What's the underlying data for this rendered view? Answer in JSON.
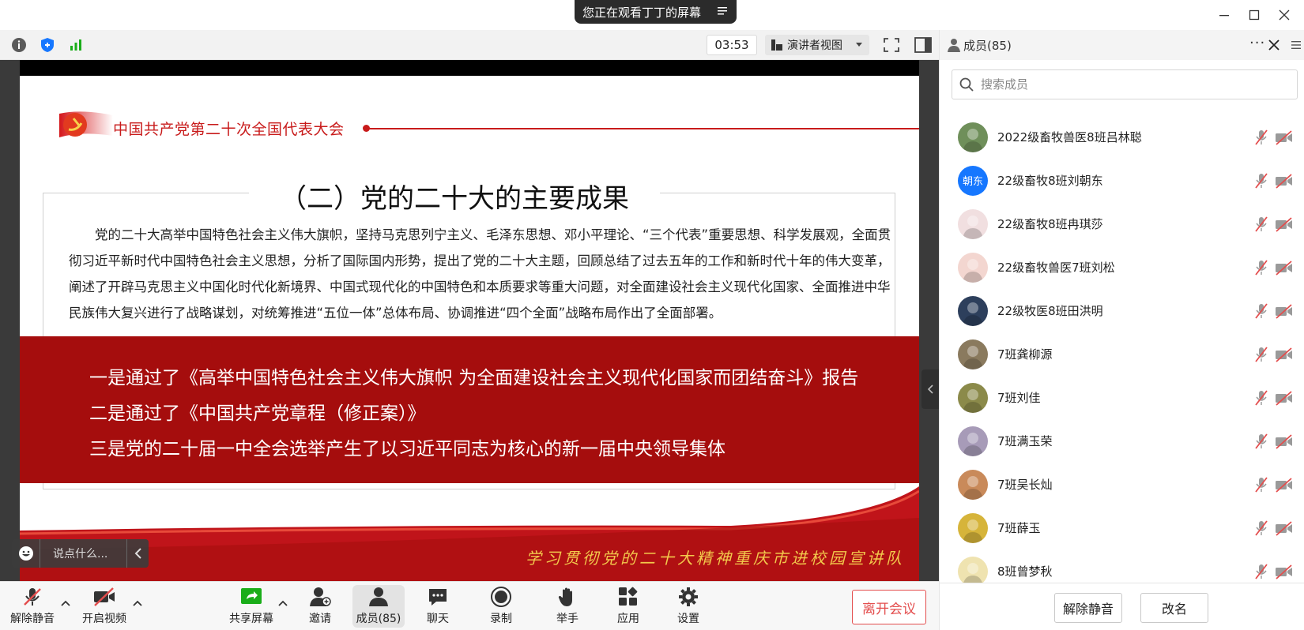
{
  "share_banner": {
    "text": "您正在观看丁丁的屏幕",
    "menu_icon": "menu-lines-icon"
  },
  "window_controls": [
    "minimize-icon",
    "maximize-icon",
    "close-icon"
  ],
  "meeting_toolbar": {
    "timer": "03:53",
    "view_mode": "演讲者视图",
    "icons": [
      "info-icon",
      "security-shield-icon",
      "signal-bars-icon",
      "fullscreen-icon",
      "layout-toggle-icon"
    ]
  },
  "slide": {
    "congress_title": "中国共产党第二十次全国代表大会",
    "section_title": "（二）党的二十大的主要成果",
    "paragraph": "党的二十大高举中国特色社会主义伟大旗帜，坚持马克思列宁主义、毛泽东思想、邓小平理论、“三个代表”重要思想、科学发展观，全面贯彻习近平新时代中国特色社会主义思想，分析了国际国内形势，提出了党的二十大主题，回顾总结了过去五年的工作和新时代十年的伟大变革，阐述了开辟马克思主义中国化时代化新境界、中国式现代化的中国特色和本质要求等重大问题，对全面建设社会主义现代化国家、全面推进中华民族伟大复兴进行了战略谋划，对统筹推进“五位一体”总体布局、协调推进“四个全面”战略布局作出了全面部署。",
    "points": [
      "一是通过了《高举中国特色社会主义伟大旗帜  为全面建设社会主义现代化国家而团结奋斗》报告",
      "二是通过了《中国共产党章程（修正案）》",
      "三是党的二十届一中全会选举产生了以习近平同志为核心的新一届中央领导集体"
    ],
    "ribbon_text": "学习贯彻党的二十大精神重庆市进校园宣讲队",
    "colors": {
      "party_red": "#a50d0d",
      "title_red": "#c81b1b",
      "ribbon_gold": "#f2c94c"
    }
  },
  "chat_input": {
    "placeholder": "说点什么...",
    "icon": "emoji-face-icon",
    "collapse_icon": "chevron-left-icon"
  },
  "controls": {
    "mute": "解除静音",
    "video": "开启视频",
    "share": "共享屏幕",
    "invite": "邀请",
    "members": "成员(85)",
    "chat": "聊天",
    "record": "录制",
    "raise_hand": "举手",
    "apps": "应用",
    "settings": "设置",
    "leave": "离开会议"
  },
  "members_panel": {
    "title": "成员(85)",
    "search_placeholder": "搜索成员",
    "members": [
      {
        "name": "2022级畜牧兽医8班吕林聪",
        "avatar": "photo",
        "avatar_color": "#6f8f5a"
      },
      {
        "name": "22级畜牧8班刘朝东",
        "avatar": "朝东",
        "avatar_color": "#1677ff"
      },
      {
        "name": "22级畜牧8班冉琪莎",
        "avatar": "photo",
        "avatar_color": "#f1dfe0"
      },
      {
        "name": "22级畜牧兽医7班刘松",
        "avatar": "photo",
        "avatar_color": "#f3d6d0"
      },
      {
        "name": "22级牧医8班田洪明",
        "avatar": "photo",
        "avatar_color": "#2d3f5c"
      },
      {
        "name": "7班龚柳源",
        "avatar": "photo",
        "avatar_color": "#8a7a5e"
      },
      {
        "name": "7班刘佳",
        "avatar": "photo",
        "avatar_color": "#8b8a4a"
      },
      {
        "name": "7班满玉荣",
        "avatar": "photo",
        "avatar_color": "#a79bb8"
      },
      {
        "name": "7班吴长灿",
        "avatar": "photo",
        "avatar_color": "#c98a5a"
      },
      {
        "name": "7班薛玉",
        "avatar": "photo",
        "avatar_color": "#d6b43a"
      },
      {
        "name": "8班曾梦秋",
        "avatar": "photo",
        "avatar_color": "#efe3b0"
      }
    ],
    "unmute_button": "解除静音",
    "rename_button": "改名"
  }
}
